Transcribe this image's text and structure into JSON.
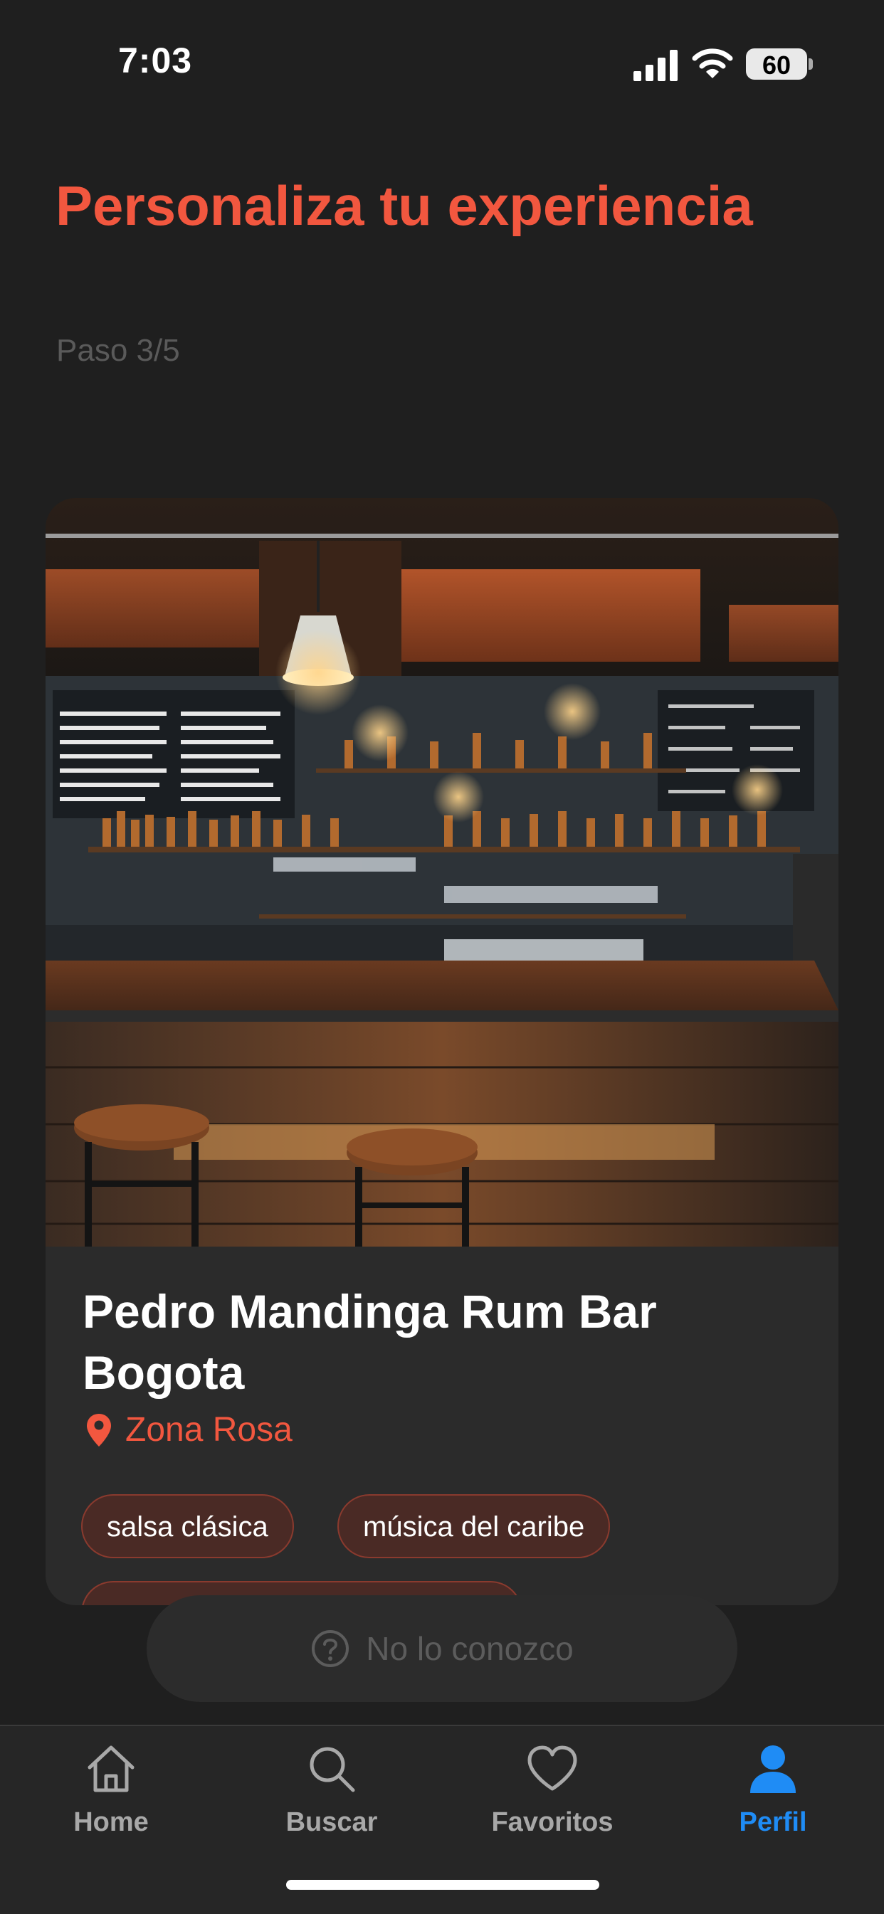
{
  "status_bar": {
    "time": "7:03",
    "battery": "60"
  },
  "header": {
    "title": "Personaliza tu experiencia",
    "step": "Paso 3/5"
  },
  "card": {
    "venue_name": "Pedro Mandinga Rum Bar Bogota",
    "location": "Zona Rosa",
    "tags": [
      "salsa clásica",
      "música del caribe"
    ]
  },
  "actions": {
    "unknown_label": "No lo conozco"
  },
  "tab_bar": {
    "items": [
      {
        "label": "Home",
        "icon": "home-icon"
      },
      {
        "label": "Buscar",
        "icon": "search-icon"
      },
      {
        "label": "Favoritos",
        "icon": "heart-icon"
      },
      {
        "label": "Perfil",
        "icon": "person-icon"
      }
    ],
    "active": "Perfil"
  },
  "colors": {
    "accent": "#f2573f",
    "active_tab": "#1f8cf5",
    "background": "#1f1f1f"
  }
}
